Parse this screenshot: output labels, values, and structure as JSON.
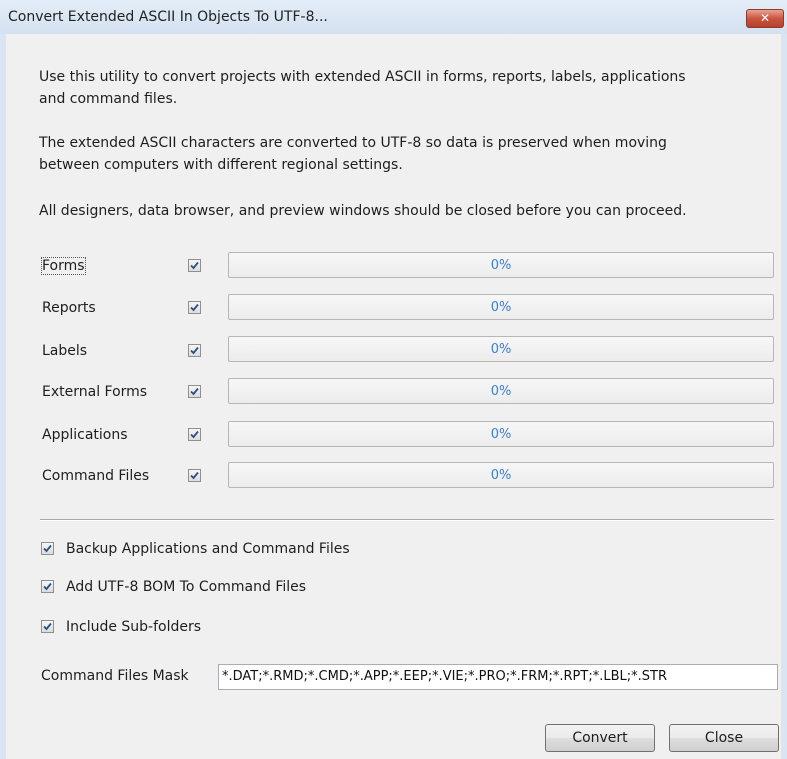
{
  "window": {
    "title": "Convert Extended ASCII In Objects To UTF-8...",
    "close_glyph": "✕"
  },
  "description": {
    "paragraph1_line1": "Use this utility to convert projects with extended ASCII in forms, reports, labels, applications",
    "paragraph1_line2": "and command files.",
    "paragraph2_line1": "The extended ASCII characters are converted to UTF-8 so data is preserved when moving",
    "paragraph2_line2": "between computers with different regional settings.",
    "paragraph3": "All designers, data browser, and preview windows should be closed before you can proceed."
  },
  "rows": [
    {
      "label": "Forms",
      "checked": true,
      "progress": 0,
      "progress_text": "0%"
    },
    {
      "label": "Reports",
      "checked": true,
      "progress": 0,
      "progress_text": "0%"
    },
    {
      "label": "Labels",
      "checked": true,
      "progress": 0,
      "progress_text": "0%"
    },
    {
      "label": "External Forms",
      "checked": true,
      "progress": 0,
      "progress_text": "0%"
    },
    {
      "label": "Applications",
      "checked": true,
      "progress": 0,
      "progress_text": "0%"
    },
    {
      "label": "Command Files",
      "checked": true,
      "progress": 0,
      "progress_text": "0%"
    }
  ],
  "options": [
    {
      "label": "Backup Applications and Command Files",
      "checked": true
    },
    {
      "label": "Add UTF-8 BOM To Command Files",
      "checked": true
    },
    {
      "label": "Include Sub-folders",
      "checked": true
    }
  ],
  "mask": {
    "label": "Command Files Mask",
    "value": "*.DAT;*.RMD;*.CMD;*.APP;*.EEP;*.VIE;*.PRO;*.FRM;*.RPT;*.LBL;*.STR"
  },
  "buttons": {
    "convert": "Convert",
    "close": "Close"
  },
  "colors": {
    "progress_text": "#3c7ed4",
    "checkmark": "#2c4f87",
    "close_button": "#c9553f"
  },
  "icons": {
    "close": "close-icon",
    "check": "checkmark-icon"
  }
}
